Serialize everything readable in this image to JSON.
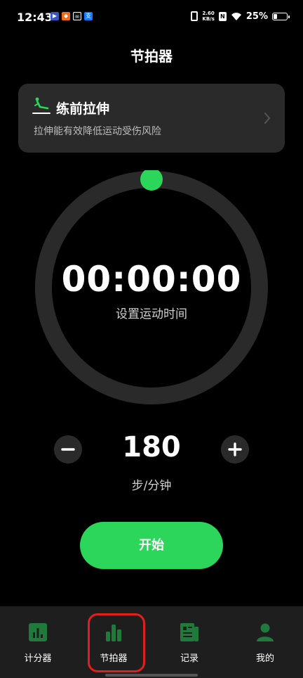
{
  "status_bar": {
    "time": "12:43",
    "net_speed_value": "2.60",
    "net_speed_unit": "KB/s",
    "battery_percent": "25%",
    "battery_level": 0.25
  },
  "header": {
    "title": "节拍器"
  },
  "stretch_card": {
    "title": "练前拉伸",
    "subtitle": "拉伸能有效降低运动受伤风险"
  },
  "timer": {
    "value": "00:00:00",
    "label": "设置运动时间",
    "progress": 0
  },
  "tempo": {
    "value": "180",
    "unit": "步/分钟"
  },
  "start_button": {
    "label": "开始"
  },
  "bottom_nav": {
    "items": [
      {
        "label": "计分器",
        "icon": "bar-chart-square-icon"
      },
      {
        "label": "节拍器",
        "icon": "bars-icon"
      },
      {
        "label": "记录",
        "icon": "document-icon"
      },
      {
        "label": "我的",
        "icon": "person-icon"
      }
    ],
    "selected_index": 1
  },
  "colors": {
    "accent": "#2bd65a",
    "card_bg": "#2a2a2a",
    "ring_track": "#2a2a2a",
    "nav_bg": "#1e1e1e",
    "highlight": "#e0201e"
  }
}
